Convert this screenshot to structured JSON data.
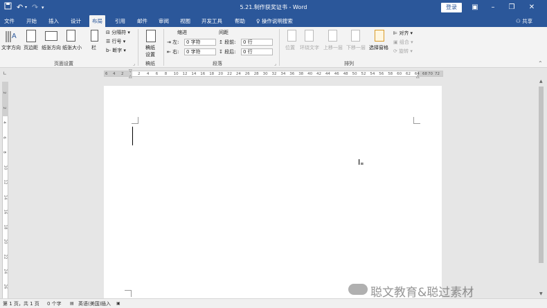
{
  "title_bar": {
    "document_title": "5.21.制作获奖证书 - Word",
    "login_label": "登录",
    "quick_access": [
      "save-icon",
      "undo-icon",
      "redo-icon",
      "customize-icon"
    ],
    "window_controls": [
      "ribbon-display-icon",
      "minimize-icon",
      "restore-icon",
      "close-icon"
    ]
  },
  "tabs": [
    {
      "label": "文件",
      "active": false
    },
    {
      "label": "开始",
      "active": false
    },
    {
      "label": "插入",
      "active": false
    },
    {
      "label": "设计",
      "active": false
    },
    {
      "label": "布局",
      "active": true
    },
    {
      "label": "引用",
      "active": false
    },
    {
      "label": "邮件",
      "active": false
    },
    {
      "label": "审阅",
      "active": false
    },
    {
      "label": "视图",
      "active": false
    },
    {
      "label": "开发工具",
      "active": false
    },
    {
      "label": "帮助",
      "active": false
    }
  ],
  "tell_me": "操作说明搜索",
  "share": "共享",
  "ribbon": {
    "page_setup": {
      "text_direction": "文字方向",
      "margins": "页边距",
      "orientation": "纸张方向",
      "size": "纸张大小",
      "columns": "栏",
      "breaks": "分隔符",
      "line_numbers": "行号",
      "hyphenation": "断字",
      "group_label": "页面设置"
    },
    "manuscript": {
      "button_line1": "稿纸",
      "button_line2": "设置",
      "group_label": "稿纸"
    },
    "paragraph": {
      "indent_label": "缩进",
      "spacing_label": "间距",
      "left_label": "左:",
      "left_value": "0 字符",
      "right_label": "右:",
      "right_value": "0 字符",
      "before_label": "段前:",
      "before_value": "0 行",
      "after_label": "段后:",
      "after_value": "0 行",
      "group_label": "段落"
    },
    "arrange": {
      "position": "位置",
      "wrap_text": "环绕文字",
      "bring_forward": "上移一层",
      "send_backward": "下移一层",
      "selection_pane": "选择窗格",
      "align": "对齐",
      "group": "组合",
      "rotate": "旋转",
      "group_label": "排列"
    }
  },
  "ruler": {
    "left_numbers": [
      "6",
      "4",
      "2"
    ],
    "numbers": [
      "2",
      "4",
      "6",
      "8",
      "10",
      "12",
      "14",
      "16",
      "18",
      "20",
      "22",
      "24",
      "26",
      "28",
      "30",
      "32",
      "34",
      "36",
      "38",
      "40",
      "42",
      "44",
      "46",
      "48",
      "50",
      "52",
      "54",
      "56",
      "58",
      "60",
      "62",
      "64"
    ],
    "right_numbers": [
      "68",
      "70",
      "72"
    ]
  },
  "vertical_ruler_numbers": [
    "2",
    "2",
    "4",
    "6",
    "8",
    "10",
    "12",
    "14",
    "16",
    "18",
    "20",
    "22",
    "24",
    "26"
  ],
  "status_bar": {
    "page": "第 1 页，共 1 页",
    "words": "0 个字",
    "language": "英语(美国)",
    "mode": "插入"
  },
  "watermark": "聪文教育&聪过素材"
}
